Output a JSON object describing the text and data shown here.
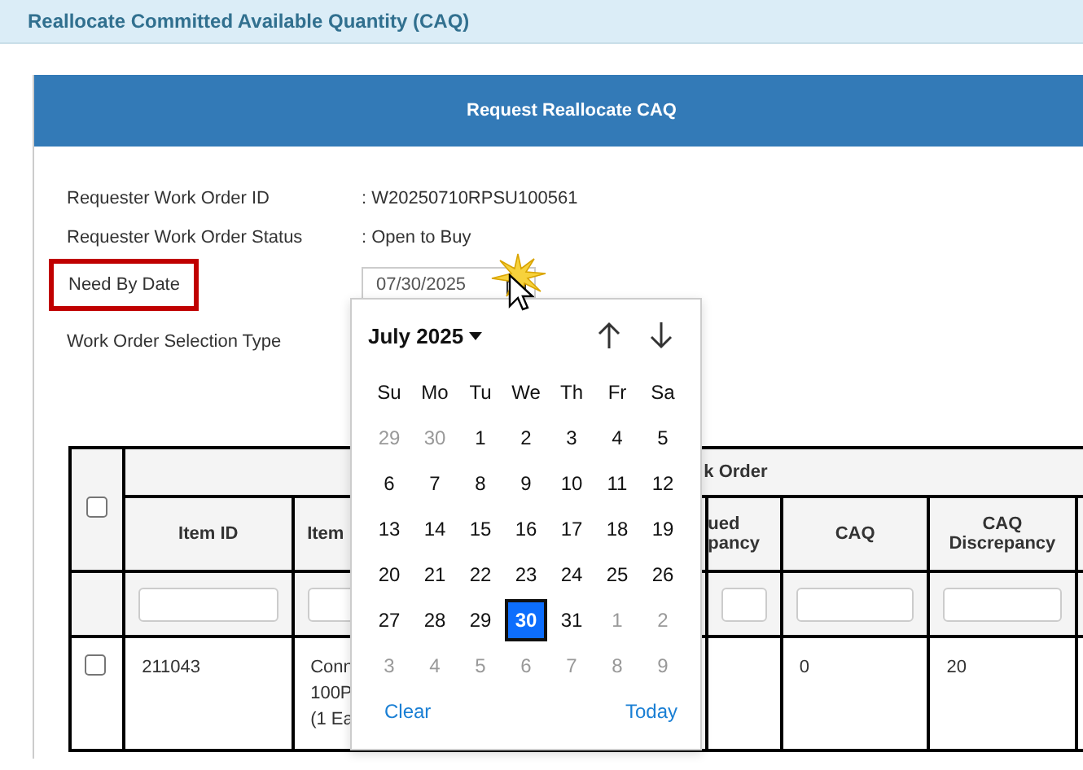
{
  "page_title": "Reallocate Committed Available Quantity (CAQ)",
  "panel": {
    "title": "Request Reallocate CAQ"
  },
  "fields": [
    {
      "kind": "text",
      "label": "Requester Work Order ID",
      "value": ": W20250710RPSU100561",
      "highlighted": false
    },
    {
      "kind": "text",
      "label": "Requester Work Order Status",
      "value": ": Open to Buy",
      "highlighted": false
    },
    {
      "kind": "date",
      "label": "Need By Date",
      "value": "07/30/2025",
      "highlighted": true
    },
    {
      "kind": "empty",
      "label": "Work Order Selection Type",
      "highlighted": false
    }
  ],
  "datepicker": {
    "month": "July 2025",
    "weekdays": [
      "Su",
      "Mo",
      "Tu",
      "We",
      "Th",
      "Fr",
      "Sa"
    ],
    "weeks": [
      [
        {
          "day": "29",
          "outside": true,
          "selected": false
        },
        {
          "day": "30",
          "outside": true,
          "selected": false
        },
        {
          "day": "1",
          "outside": false,
          "selected": false
        },
        {
          "day": "2",
          "outside": false,
          "selected": false
        },
        {
          "day": "3",
          "outside": false,
          "selected": false
        },
        {
          "day": "4",
          "outside": false,
          "selected": false
        },
        {
          "day": "5",
          "outside": false,
          "selected": false
        }
      ],
      [
        {
          "day": "6",
          "outside": false,
          "selected": false
        },
        {
          "day": "7",
          "outside": false,
          "selected": false
        },
        {
          "day": "8",
          "outside": false,
          "selected": false
        },
        {
          "day": "9",
          "outside": false,
          "selected": false
        },
        {
          "day": "10",
          "outside": false,
          "selected": false
        },
        {
          "day": "11",
          "outside": false,
          "selected": false
        },
        {
          "day": "12",
          "outside": false,
          "selected": false
        }
      ],
      [
        {
          "day": "13",
          "outside": false,
          "selected": false
        },
        {
          "day": "14",
          "outside": false,
          "selected": false
        },
        {
          "day": "15",
          "outside": false,
          "selected": false
        },
        {
          "day": "16",
          "outside": false,
          "selected": false
        },
        {
          "day": "17",
          "outside": false,
          "selected": false
        },
        {
          "day": "18",
          "outside": false,
          "selected": false
        },
        {
          "day": "19",
          "outside": false,
          "selected": false
        }
      ],
      [
        {
          "day": "20",
          "outside": false,
          "selected": false
        },
        {
          "day": "21",
          "outside": false,
          "selected": false
        },
        {
          "day": "22",
          "outside": false,
          "selected": false
        },
        {
          "day": "23",
          "outside": false,
          "selected": false
        },
        {
          "day": "24",
          "outside": false,
          "selected": false
        },
        {
          "day": "25",
          "outside": false,
          "selected": false
        },
        {
          "day": "26",
          "outside": false,
          "selected": false
        }
      ],
      [
        {
          "day": "27",
          "outside": false,
          "selected": false
        },
        {
          "day": "28",
          "outside": false,
          "selected": false
        },
        {
          "day": "29",
          "outside": false,
          "selected": false
        },
        {
          "day": "30",
          "outside": false,
          "selected": true
        },
        {
          "day": "31",
          "outside": false,
          "selected": false
        },
        {
          "day": "1",
          "outside": true,
          "selected": false
        },
        {
          "day": "2",
          "outside": true,
          "selected": false
        }
      ],
      [
        {
          "day": "3",
          "outside": true,
          "selected": false
        },
        {
          "day": "4",
          "outside": true,
          "selected": false
        },
        {
          "day": "5",
          "outside": true,
          "selected": false
        },
        {
          "day": "6",
          "outside": true,
          "selected": false
        },
        {
          "day": "7",
          "outside": true,
          "selected": false
        },
        {
          "day": "8",
          "outside": true,
          "selected": false
        },
        {
          "day": "9",
          "outside": true,
          "selected": false
        }
      ]
    ],
    "clear": "Clear",
    "today": "Today"
  },
  "table": {
    "select_all_checked": false,
    "group_header": "k Order",
    "columns": [
      {
        "label": "Item ID"
      },
      {
        "label": "Item"
      },
      {
        "label": "ued\npancy"
      },
      {
        "label": "CAQ"
      },
      {
        "label": "CAQ Discrepancy"
      },
      {}
    ],
    "rows": [
      {
        "checked": false,
        "cells": [
          "211043",
          "Conn\n100P\n(1 Ea",
          "",
          "0",
          "20",
          ""
        ]
      }
    ]
  }
}
